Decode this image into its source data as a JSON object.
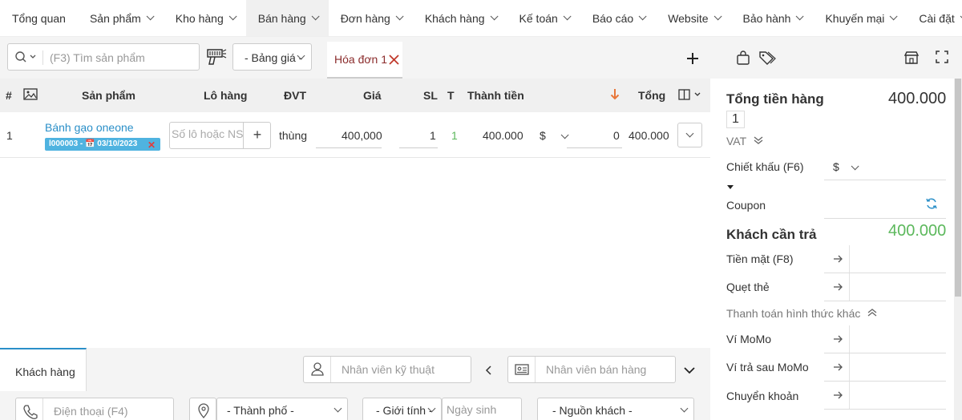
{
  "nav": {
    "items": [
      {
        "label": "Tổng quan",
        "has_menu": false
      },
      {
        "label": "Sản phẩm",
        "has_menu": true
      },
      {
        "label": "Kho hàng",
        "has_menu": true
      },
      {
        "label": "Bán hàng",
        "has_menu": true,
        "active": true
      },
      {
        "label": "Đơn hàng",
        "has_menu": true
      },
      {
        "label": "Khách hàng",
        "has_menu": true
      },
      {
        "label": "Kế toán",
        "has_menu": true
      },
      {
        "label": "Báo cáo",
        "has_menu": true
      },
      {
        "label": "Website",
        "has_menu": true
      },
      {
        "label": "Bảo hành",
        "has_menu": true
      },
      {
        "label": "Khuyến mại",
        "has_menu": true
      },
      {
        "label": "Cài đặt",
        "has_menu": true
      }
    ]
  },
  "toolbar": {
    "search_placeholder": "(F3) Tìm sản phẩm",
    "price_list": "- Bảng giá -",
    "invoice_tab": "Hóa đơn 1"
  },
  "table": {
    "headers": {
      "index": "#",
      "product": "Sản phẩm",
      "lot": "Lô hàng",
      "unit": "ĐVT",
      "price": "Giá",
      "qty": "SL",
      "t": "T",
      "subtotal": "Thành tiền",
      "total": "Tổng"
    },
    "rows": [
      {
        "index": "1",
        "product": "Bánh gạo oneone",
        "lot_badge": "l000003 - 📅 03/10/2023",
        "lot_placeholder": "Số lô hoặc NSX",
        "unit": "thùng",
        "price": "400,000",
        "qty": "1",
        "t": "1",
        "subtotal": "400.000",
        "discount_type": "$",
        "discount": "0",
        "total": "400.000"
      }
    ]
  },
  "summary": {
    "goods_total_label": "Tổng tiền hàng",
    "goods_total": "400.000",
    "goods_count": "1",
    "vat_label": "VAT",
    "discount_label": "Chiết khấu (F6)",
    "discount_type": "$",
    "coupon_label": "Coupon",
    "payable_label": "Khách cần trả",
    "payable": "400.000",
    "cash_label": "Tiền mặt (F8)",
    "card_label": "Quẹt thẻ",
    "other_label": "Thanh toán hình thức khác",
    "momo_label": "Ví MoMo",
    "momo_later_label": "Ví trả sau MoMo",
    "transfer_label": "Chuyển khoản"
  },
  "bottom": {
    "customer_tab": "Khách hàng",
    "technician_placeholder": "Nhân viên kỹ thuật",
    "sales_placeholder": "Nhân viên bán hàng",
    "phone_placeholder": "Điện thoại (F4)",
    "city": "- Thành phố -",
    "gender": "- Giới tính -",
    "birthday_placeholder": "Ngày sinh",
    "source": "- Nguồn khách -"
  },
  "colors": {
    "accent_blue": "#2a8fc8",
    "payable_green": "#5cb85c",
    "invoice_red": "#8b2c2c",
    "sort_orange": "#e8773a"
  }
}
